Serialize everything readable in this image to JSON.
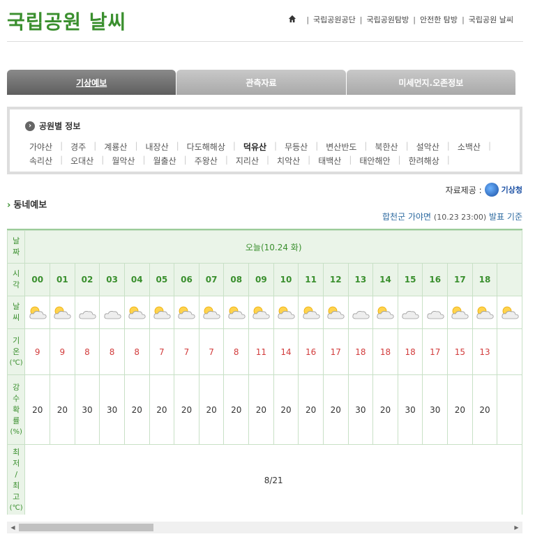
{
  "header": {
    "title": "국립공원 날씨",
    "nav": [
      "국립공원공단",
      "국립공원탐방",
      "안전한 탐방",
      "국립공원 날씨"
    ]
  },
  "tabs": [
    {
      "label": "기상예보",
      "active": true
    },
    {
      "label": "관측자료",
      "active": false
    },
    {
      "label": "미세먼지.오존정보",
      "active": false
    }
  ],
  "parks": {
    "title": "공원별 정보",
    "row1": [
      "가야산",
      "경주",
      "계룡산",
      "내장산",
      "다도해해상",
      "덕유산",
      "무등산",
      "변산반도",
      "북한산",
      "설악산",
      "소백산"
    ],
    "row2": [
      "속리산",
      "오대산",
      "월악산",
      "월출산",
      "주왕산",
      "지리산",
      "치악산",
      "태백산",
      "태안해안",
      "한려해상"
    ],
    "selected": "덕유산"
  },
  "source": {
    "label": "자료제공 :",
    "provider": "기상청"
  },
  "section": {
    "title": "동네예보"
  },
  "issued": {
    "location": "합천군 가야면",
    "time": "(10.23 23:00)",
    "suffix": "발표 기준"
  },
  "forecast": {
    "row_labels": {
      "date": "날짜",
      "hour": "시각",
      "weather": "날씨",
      "temp": "기온(℃)",
      "rain": "강수확률(%)",
      "minmax": "최저/최고(℃)"
    },
    "date_label": "오늘(10.24 화)",
    "hours": [
      "00",
      "01",
      "02",
      "03",
      "04",
      "05",
      "06",
      "07",
      "08",
      "09",
      "10",
      "11",
      "12",
      "13",
      "14",
      "15",
      "16",
      "17",
      "18"
    ],
    "weather": [
      "partly-cloudy",
      "partly-cloudy",
      "cloudy",
      "cloudy",
      "partly-cloudy",
      "partly-cloudy",
      "partly-cloudy",
      "partly-cloudy",
      "partly-cloudy",
      "partly-cloudy",
      "partly-cloudy",
      "partly-cloudy",
      "partly-cloudy",
      "cloudy",
      "partly-cloudy",
      "cloudy",
      "cloudy",
      "partly-cloudy",
      "partly-cloudy"
    ],
    "temps": [
      "9",
      "9",
      "8",
      "8",
      "8",
      "7",
      "7",
      "7",
      "8",
      "11",
      "14",
      "16",
      "17",
      "18",
      "18",
      "18",
      "17",
      "15",
      "13"
    ],
    "rain": [
      "20",
      "20",
      "30",
      "30",
      "20",
      "20",
      "20",
      "20",
      "20",
      "20",
      "20",
      "20",
      "20",
      "30",
      "20",
      "30",
      "30",
      "20",
      "20"
    ],
    "minmax": "8/21"
  },
  "scrollbar": {
    "position": 0.0
  }
}
